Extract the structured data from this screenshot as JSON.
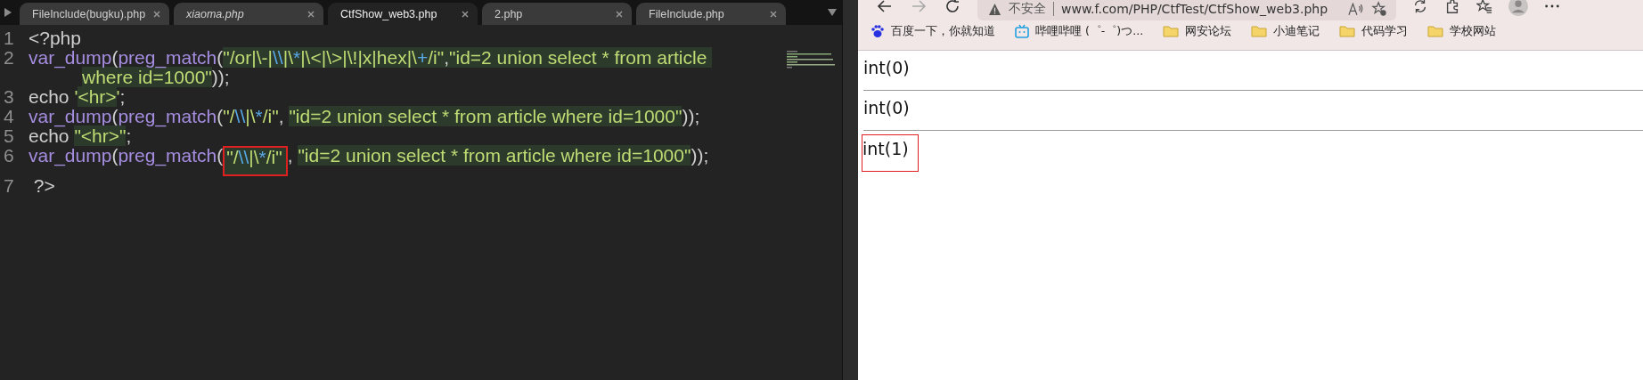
{
  "editor": {
    "tabs": [
      {
        "label": "FileInclude(bugku).php",
        "selected": false,
        "italic": false
      },
      {
        "label": "xiaoma.php",
        "selected": false,
        "italic": true
      },
      {
        "label": "CtfShow_web3.php",
        "selected": true,
        "italic": false
      },
      {
        "label": "2.php",
        "selected": false,
        "italic": false
      },
      {
        "label": "FileInclude.php",
        "selected": false,
        "italic": false
      }
    ],
    "lines": [
      {
        "number": "1",
        "tokens": [
          {
            "kind": "plain",
            "text": "<?php",
            "hl": false,
            "boxed": false
          }
        ]
      },
      {
        "number": "2",
        "tokens": [
          {
            "kind": "func",
            "text": "var_dump",
            "hl": false,
            "boxed": false
          },
          {
            "kind": "plain",
            "text": "(",
            "hl": false,
            "boxed": false
          },
          {
            "kind": "func",
            "text": "preg_match",
            "hl": false,
            "boxed": false
          },
          {
            "kind": "plain",
            "text": "(",
            "hl": false,
            "boxed": false
          },
          {
            "kind": "string",
            "text": "\"/or|\\-|",
            "hl": true,
            "boxed": false
          },
          {
            "kind": "escape",
            "text": "\\\\",
            "hl": true,
            "boxed": false
          },
          {
            "kind": "string",
            "text": "|\\",
            "hl": true,
            "boxed": false
          },
          {
            "kind": "escape",
            "text": "*",
            "hl": true,
            "boxed": false
          },
          {
            "kind": "string",
            "text": "|\\<|\\>|\\!|x|hex|\\",
            "hl": true,
            "boxed": false
          },
          {
            "kind": "escape",
            "text": "+",
            "hl": true,
            "boxed": false
          },
          {
            "kind": "string",
            "text": "/i\"",
            "hl": true,
            "boxed": false
          },
          {
            "kind": "plain",
            "text": ",",
            "hl": true,
            "boxed": false
          },
          {
            "kind": "string",
            "text": "\"id=2 union select * from article ",
            "hl": true,
            "boxed": false
          }
        ],
        "continuation": [
          {
            "kind": "string",
            "text": "where id=1000\"",
            "hl": true,
            "boxed": false
          },
          {
            "kind": "plain",
            "text": "));",
            "hl": false,
            "boxed": false
          }
        ]
      },
      {
        "number": "3",
        "tokens": [
          {
            "kind": "plain",
            "text": "echo ",
            "hl": false,
            "boxed": false
          },
          {
            "kind": "string",
            "text": "'",
            "hl": false,
            "boxed": false
          },
          {
            "kind": "string",
            "text": "<hr>",
            "hl": true,
            "boxed": false
          },
          {
            "kind": "string",
            "text": "'",
            "hl": false,
            "boxed": false
          },
          {
            "kind": "plain",
            "text": ";",
            "hl": false,
            "boxed": false
          }
        ]
      },
      {
        "number": "4",
        "tokens": [
          {
            "kind": "func",
            "text": "var_dump",
            "hl": false,
            "boxed": false
          },
          {
            "kind": "plain",
            "text": "(",
            "hl": false,
            "boxed": false
          },
          {
            "kind": "func",
            "text": "preg_match",
            "hl": false,
            "boxed": false
          },
          {
            "kind": "plain",
            "text": "(",
            "hl": false,
            "boxed": false
          },
          {
            "kind": "string",
            "text": "\"/",
            "hl": false,
            "boxed": false
          },
          {
            "kind": "escape",
            "text": "\\\\",
            "hl": false,
            "boxed": false
          },
          {
            "kind": "string",
            "text": "|\\",
            "hl": false,
            "boxed": false
          },
          {
            "kind": "escape",
            "text": "*",
            "hl": false,
            "boxed": false
          },
          {
            "kind": "string",
            "text": "/i\"",
            "hl": false,
            "boxed": false
          },
          {
            "kind": "plain",
            "text": ", ",
            "hl": false,
            "boxed": false
          },
          {
            "kind": "string",
            "text": "\"id=2 union select * from article where id=1000\"",
            "hl": true,
            "boxed": false
          },
          {
            "kind": "plain",
            "text": "));",
            "hl": false,
            "boxed": false
          }
        ]
      },
      {
        "number": "5",
        "tokens": [
          {
            "kind": "plain",
            "text": "echo ",
            "hl": false,
            "boxed": false
          },
          {
            "kind": "string",
            "text": "\"<hr>\"",
            "hl": true,
            "boxed": false
          },
          {
            "kind": "plain",
            "text": ";",
            "hl": false,
            "boxed": false
          }
        ]
      },
      {
        "number": "6",
        "tokens": [
          {
            "kind": "func",
            "text": "var_dump",
            "hl": false,
            "boxed": false
          },
          {
            "kind": "plain",
            "text": "(",
            "hl": false,
            "boxed": false
          },
          {
            "kind": "func",
            "text": "preg_match",
            "hl": false,
            "boxed": false
          },
          {
            "kind": "plain",
            "text": "(",
            "hl": false,
            "boxed": false
          },
          {
            "kind": "string",
            "text": "\"/",
            "hl": true,
            "boxed": true
          },
          {
            "kind": "escape",
            "text": "\\\\",
            "hl": true,
            "boxed": true
          },
          {
            "kind": "string",
            "text": "|\\",
            "hl": true,
            "boxed": true
          },
          {
            "kind": "escape",
            "text": "*",
            "hl": true,
            "boxed": true
          },
          {
            "kind": "string",
            "text": "/i\"",
            "hl": true,
            "boxed": true
          },
          {
            "kind": "plain",
            "text": ", ",
            "hl": false,
            "boxed": false
          },
          {
            "kind": "string",
            "text": "\"id=2 union select * from article where id=1000\"",
            "hl": true,
            "boxed": false
          },
          {
            "kind": "plain",
            "text": "));",
            "hl": false,
            "boxed": false
          }
        ]
      },
      {
        "number": "7",
        "tokens": [
          {
            "kind": "plain",
            "text": " ?>",
            "hl": false,
            "boxed": false
          }
        ]
      }
    ]
  },
  "browser": {
    "address": {
      "security": "不安全",
      "url": "www.f.com/PHP/CtfTest/CtfShow_web3.php"
    },
    "bookmarks": [
      {
        "kind": "baidu",
        "label": "百度一下，你就知道"
      },
      {
        "kind": "tv",
        "label": "哔哩哔哩 (゜-゜)つ..."
      },
      {
        "kind": "folder",
        "label": "网安论坛"
      },
      {
        "kind": "folder",
        "label": "小迪笔记"
      },
      {
        "kind": "folder",
        "label": "代码学习"
      },
      {
        "kind": "folder",
        "label": "学校网站"
      }
    ],
    "output": [
      {
        "text": "int(0)",
        "boxed": false
      },
      {
        "text": "int(0)",
        "boxed": false
      },
      {
        "text": "int(1)",
        "boxed": true
      }
    ]
  }
}
